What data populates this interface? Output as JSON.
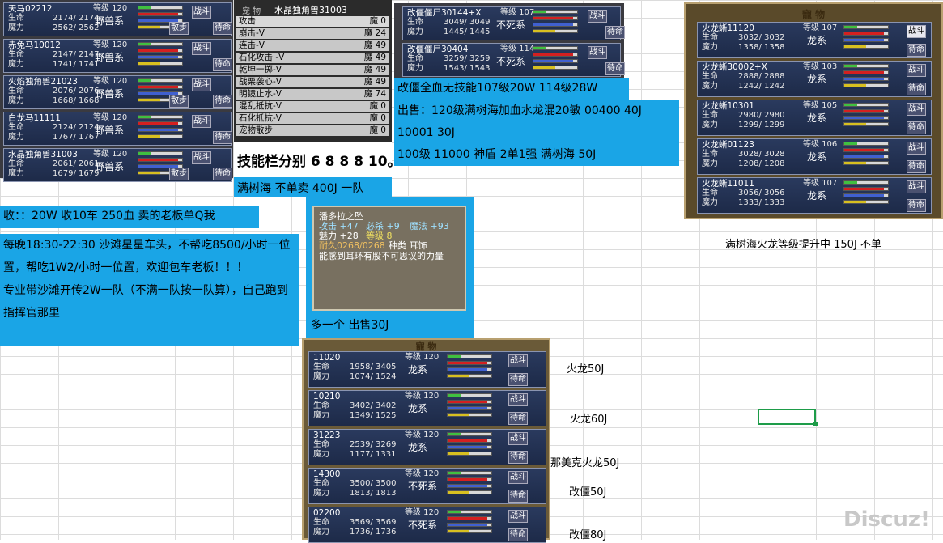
{
  "colors": {
    "accent_blue": "#1aa5e6",
    "hp_bar": "#d42020",
    "mp_bar": "#d8c020",
    "exp_bar": "#40c040",
    "loyal_bar": "#4060d0"
  },
  "panel_a": {
    "pets": [
      {
        "name": "天马02212",
        "level": "等级 120",
        "hp": "2174/  2174",
        "mp": "2562/  2562",
        "race": "野兽系",
        "b1": "战斗",
        "b2": "散步",
        "b3": "待命"
      },
      {
        "name": "赤兔马10012",
        "level": "等级 120",
        "hp": "2147/  2147",
        "mp": "1741/  1741",
        "race": "野兽系",
        "b1": "战斗",
        "b2": "",
        "b3": "待命"
      },
      {
        "name": "火焰独角兽21023",
        "level": "等级 120",
        "hp": "2076/  2076",
        "mp": "1668/  1668",
        "race": "野兽系",
        "b1": "战斗",
        "b2": "散步",
        "b3": "待命"
      },
      {
        "name": "白龙马11111",
        "level": "等级 120",
        "hp": "2124/  2124",
        "mp": "1767/  1767",
        "race": "野兽系",
        "b1": "战斗",
        "b2": "",
        "b3": "待命"
      },
      {
        "name": "水晶独角兽31003",
        "level": "等级 120",
        "hp": "2061/  2061",
        "mp": "1679/  1679",
        "race": "野兽系",
        "b1": "战斗",
        "b2": "散步",
        "b3": "待命"
      }
    ],
    "hp_label": "生命",
    "mp_label": "魔力"
  },
  "skill_panel": {
    "title": "水晶独角兽31003",
    "header": "宠  物",
    "skills": [
      {
        "name": "攻击",
        "cost": "魔  0"
      },
      {
        "name": "崩击-V",
        "cost": "魔 24"
      },
      {
        "name": "连击-V",
        "cost": "魔 49"
      },
      {
        "name": "石化攻击 -V",
        "cost": "魔 49"
      },
      {
        "name": "乾坤一掷-V",
        "cost": "魔 49"
      },
      {
        "name": "战栗袭心-V",
        "cost": "魔 49"
      },
      {
        "name": "明镜止水-V",
        "cost": "魔 74"
      },
      {
        "name": "混乱抵抗-V",
        "cost": "魔  0"
      },
      {
        "name": "石化抵抗-V",
        "cost": "魔  0"
      },
      {
        "name": "宠物散步",
        "cost": "魔  0"
      }
    ],
    "caption": "技能栏分别 6 8 8 8 10。",
    "note": "满树海 不单卖 400J 一队"
  },
  "panel_c": {
    "pets": [
      {
        "name": "改僵僵尸30144+X",
        "level": "等级 107",
        "hp": "3049/  3049",
        "mp": "1445/  1445",
        "race": "不死系",
        "b1": "战斗",
        "b3": "待命"
      },
      {
        "name": "改僵僵尸30404",
        "level": "等级 114",
        "hp": "3259/  3259",
        "mp": "1543/  1543",
        "race": "不死系",
        "b1": "战斗",
        "b3": "待命"
      }
    ],
    "line1": "改僵全血无技能107级20W    114级28W",
    "line2": "出售：120级满树海加血水龙混20敏    00400  40J",
    "line3": "10001 30J",
    "line4": "100级 11000  神盾 2单1强  满树海 50J"
  },
  "panel_d": {
    "header": "寵  物",
    "pets": [
      {
        "name": "火龙蜥11120",
        "level": "等级 107",
        "hp": "3032/  3032",
        "mp": "1358/  1358",
        "race": "龙系",
        "b1": "战斗",
        "b3": "待命",
        "sel": true
      },
      {
        "name": "火龙蜥30002+X",
        "level": "等级 103",
        "hp": "2888/  2888",
        "mp": "1242/  1242",
        "race": "龙系",
        "b1": "战斗",
        "b3": "待命"
      },
      {
        "name": "火龙蜥10301",
        "level": "等级 105",
        "hp": "2980/  2980",
        "mp": "1299/  1299",
        "race": "龙系",
        "b1": "战斗",
        "b3": "待命"
      },
      {
        "name": "火龙蜥01123",
        "level": "等级 106",
        "hp": "3028/  3028",
        "mp": "1208/  1208",
        "race": "龙系",
        "b1": "战斗",
        "b3": "待命"
      },
      {
        "name": "火龙蜥11011",
        "level": "等级 107",
        "hp": "3056/  3056",
        "mp": "1333/  1333",
        "race": "龙系",
        "b1": "战斗",
        "b3": "待命"
      }
    ],
    "note": "满树海火龙等级提升中  150J  不单"
  },
  "left_text": {
    "recv": "收：：20W 收10车 250血   卖的老板单Q我",
    "p1": "每晚18:30-22:30 沙滩星星车头，不帮吃8500/小时一位置，帮吃1W2/小时一位置，欢迎包车老板！！！",
    "p2": "专业带沙滩开传2W一队（不满一队按一队算），自己跑到指挥官那里"
  },
  "item": {
    "name": "潘多拉之坠",
    "l1a": "攻击 +47",
    "l1b": "必杀  +9",
    "l1c": "魔法 +93",
    "l2a": "魅力 +28",
    "l2b": "等级 8",
    "l3a": "耐久0268/0268",
    "l3b": "种类 耳饰",
    "desc": "能感到耳环有股不可思议的力量",
    "note": "多一个 出售30J"
  },
  "panel_e": {
    "header": "寵  物",
    "pets": [
      {
        "name": "11020",
        "level": "等级 120",
        "hp": "1958/  3405",
        "mp": "1074/  1524",
        "race": "龙系",
        "b1": "战斗",
        "b3": "待命",
        "price": "火龙50J"
      },
      {
        "name": "10210",
        "level": "等级 120",
        "hp": "3402/  3402",
        "mp": "1349/  1525",
        "race": "龙系",
        "b1": "战斗",
        "b3": "待命",
        "price": "火龙60J"
      },
      {
        "name": "31223",
        "level": "等级 120",
        "hp": "2539/  3269",
        "mp": "1177/  1331",
        "race": "龙系",
        "b1": "战斗",
        "b3": "待命",
        "price": "那美克火龙50J"
      },
      {
        "name": "14300",
        "level": "等级 120",
        "hp": "3500/  3500",
        "mp": "1813/  1813",
        "race": "不死系",
        "b1": "战斗",
        "b3": "待命",
        "price": "改僵50J"
      },
      {
        "name": "02200",
        "level": "等级 120",
        "hp": "3569/  3569",
        "mp": "1736/  1736",
        "race": "不死系",
        "b1": "战斗",
        "b3": "待命",
        "price": "改僵80J"
      }
    ]
  },
  "watermark": "Discuz!"
}
